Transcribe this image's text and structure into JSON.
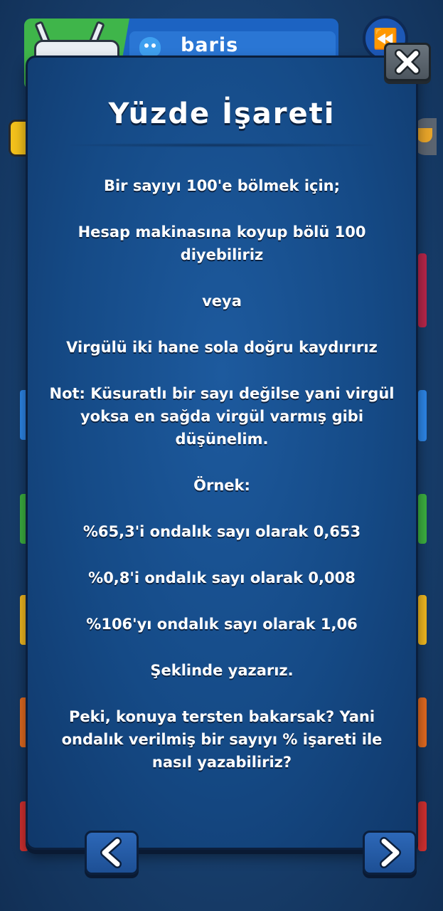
{
  "header": {
    "username": "baris"
  },
  "modal": {
    "title": "Yüzde İşareti",
    "paragraphs": [
      "Bir sayıyı 100'e bölmek için;",
      "Hesap makinasına koyup bölü 100 diyebiliriz",
      "veya",
      "Virgülü iki hane sola doğru kaydırırız",
      "Not: Küsuratlı bir sayı değilse yani virgül yoksa en sağda virgül varmış gibi düşünelim.",
      "Örnek:",
      "%65,3'i ondalık sayı olarak 0,653",
      "%0,8'i ondalık sayı olarak 0,008",
      "%106'yı ondalık sayı olarak 1,06",
      "Şeklinde yazarız.",
      "Peki, konuya tersten bakarsak? Yani ondalık verilmiş bir sayıyı % işareti ile nasıl yazabiliriz?"
    ]
  },
  "icons": {
    "close": "close-icon",
    "previous": "chevron-left-icon",
    "next": "chevron-right-icon",
    "rewind": "rewind-icon",
    "user": "user-icon"
  },
  "colors": {
    "modal_bg": "#154a86",
    "profile_card": "#1c63c2",
    "avatar_tile": "#3fb54a",
    "close_button": "#5a636c",
    "nav_button": "#2560ad"
  }
}
